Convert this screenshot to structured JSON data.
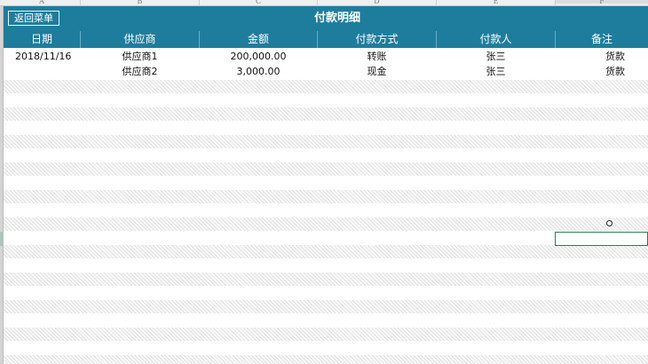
{
  "columns": [
    "A",
    "B",
    "C",
    "D",
    "E",
    "F"
  ],
  "back_button": "返回菜单",
  "title": "付款明细",
  "headers": [
    "日期",
    "供应商",
    "金额",
    "付款方式",
    "付款人",
    "备注"
  ],
  "rows": [
    {
      "date": "2018/11/16",
      "supplier": "供应商1",
      "amount": "200,000.00",
      "method": "转账",
      "payer": "张三",
      "note": "货款"
    },
    {
      "date": "",
      "supplier": "供应商2",
      "amount": "3,000.00",
      "method": "现金",
      "payer": "张三",
      "note": "货款"
    }
  ],
  "colors": {
    "header_bg": "#1e7d9d",
    "header_text": "#ffffff",
    "selection_border": "#2e7d4f"
  }
}
